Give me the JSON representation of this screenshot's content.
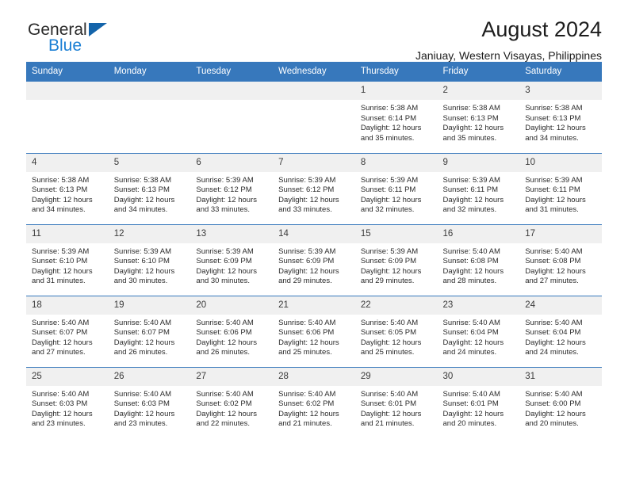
{
  "logo": {
    "word_primary": "General",
    "word_secondary": "Blue",
    "triangle_color": "#1464aa",
    "secondary_color": "#1b7fd4"
  },
  "header": {
    "title": "August 2024",
    "subtitle": "Janiuay, Western Visayas, Philippines"
  },
  "theme": {
    "header_bg": "#3778bc",
    "header_text": "#ffffff",
    "daynum_bg": "#f0f0f0",
    "row_rule": "#3778bc"
  },
  "weekdays": [
    "Sunday",
    "Monday",
    "Tuesday",
    "Wednesday",
    "Thursday",
    "Friday",
    "Saturday"
  ],
  "weeks": [
    [
      {
        "day": "",
        "sunrise": "",
        "sunset": "",
        "daylight_line1": "",
        "daylight_line2": ""
      },
      {
        "day": "",
        "sunrise": "",
        "sunset": "",
        "daylight_line1": "",
        "daylight_line2": ""
      },
      {
        "day": "",
        "sunrise": "",
        "sunset": "",
        "daylight_line1": "",
        "daylight_line2": ""
      },
      {
        "day": "",
        "sunrise": "",
        "sunset": "",
        "daylight_line1": "",
        "daylight_line2": ""
      },
      {
        "day": "1",
        "sunrise": "Sunrise: 5:38 AM",
        "sunset": "Sunset: 6:14 PM",
        "daylight_line1": "Daylight: 12 hours",
        "daylight_line2": "and 35 minutes."
      },
      {
        "day": "2",
        "sunrise": "Sunrise: 5:38 AM",
        "sunset": "Sunset: 6:13 PM",
        "daylight_line1": "Daylight: 12 hours",
        "daylight_line2": "and 35 minutes."
      },
      {
        "day": "3",
        "sunrise": "Sunrise: 5:38 AM",
        "sunset": "Sunset: 6:13 PM",
        "daylight_line1": "Daylight: 12 hours",
        "daylight_line2": "and 34 minutes."
      }
    ],
    [
      {
        "day": "4",
        "sunrise": "Sunrise: 5:38 AM",
        "sunset": "Sunset: 6:13 PM",
        "daylight_line1": "Daylight: 12 hours",
        "daylight_line2": "and 34 minutes."
      },
      {
        "day": "5",
        "sunrise": "Sunrise: 5:38 AM",
        "sunset": "Sunset: 6:13 PM",
        "daylight_line1": "Daylight: 12 hours",
        "daylight_line2": "and 34 minutes."
      },
      {
        "day": "6",
        "sunrise": "Sunrise: 5:39 AM",
        "sunset": "Sunset: 6:12 PM",
        "daylight_line1": "Daylight: 12 hours",
        "daylight_line2": "and 33 minutes."
      },
      {
        "day": "7",
        "sunrise": "Sunrise: 5:39 AM",
        "sunset": "Sunset: 6:12 PM",
        "daylight_line1": "Daylight: 12 hours",
        "daylight_line2": "and 33 minutes."
      },
      {
        "day": "8",
        "sunrise": "Sunrise: 5:39 AM",
        "sunset": "Sunset: 6:11 PM",
        "daylight_line1": "Daylight: 12 hours",
        "daylight_line2": "and 32 minutes."
      },
      {
        "day": "9",
        "sunrise": "Sunrise: 5:39 AM",
        "sunset": "Sunset: 6:11 PM",
        "daylight_line1": "Daylight: 12 hours",
        "daylight_line2": "and 32 minutes."
      },
      {
        "day": "10",
        "sunrise": "Sunrise: 5:39 AM",
        "sunset": "Sunset: 6:11 PM",
        "daylight_line1": "Daylight: 12 hours",
        "daylight_line2": "and 31 minutes."
      }
    ],
    [
      {
        "day": "11",
        "sunrise": "Sunrise: 5:39 AM",
        "sunset": "Sunset: 6:10 PM",
        "daylight_line1": "Daylight: 12 hours",
        "daylight_line2": "and 31 minutes."
      },
      {
        "day": "12",
        "sunrise": "Sunrise: 5:39 AM",
        "sunset": "Sunset: 6:10 PM",
        "daylight_line1": "Daylight: 12 hours",
        "daylight_line2": "and 30 minutes."
      },
      {
        "day": "13",
        "sunrise": "Sunrise: 5:39 AM",
        "sunset": "Sunset: 6:09 PM",
        "daylight_line1": "Daylight: 12 hours",
        "daylight_line2": "and 30 minutes."
      },
      {
        "day": "14",
        "sunrise": "Sunrise: 5:39 AM",
        "sunset": "Sunset: 6:09 PM",
        "daylight_line1": "Daylight: 12 hours",
        "daylight_line2": "and 29 minutes."
      },
      {
        "day": "15",
        "sunrise": "Sunrise: 5:39 AM",
        "sunset": "Sunset: 6:09 PM",
        "daylight_line1": "Daylight: 12 hours",
        "daylight_line2": "and 29 minutes."
      },
      {
        "day": "16",
        "sunrise": "Sunrise: 5:40 AM",
        "sunset": "Sunset: 6:08 PM",
        "daylight_line1": "Daylight: 12 hours",
        "daylight_line2": "and 28 minutes."
      },
      {
        "day": "17",
        "sunrise": "Sunrise: 5:40 AM",
        "sunset": "Sunset: 6:08 PM",
        "daylight_line1": "Daylight: 12 hours",
        "daylight_line2": "and 27 minutes."
      }
    ],
    [
      {
        "day": "18",
        "sunrise": "Sunrise: 5:40 AM",
        "sunset": "Sunset: 6:07 PM",
        "daylight_line1": "Daylight: 12 hours",
        "daylight_line2": "and 27 minutes."
      },
      {
        "day": "19",
        "sunrise": "Sunrise: 5:40 AM",
        "sunset": "Sunset: 6:07 PM",
        "daylight_line1": "Daylight: 12 hours",
        "daylight_line2": "and 26 minutes."
      },
      {
        "day": "20",
        "sunrise": "Sunrise: 5:40 AM",
        "sunset": "Sunset: 6:06 PM",
        "daylight_line1": "Daylight: 12 hours",
        "daylight_line2": "and 26 minutes."
      },
      {
        "day": "21",
        "sunrise": "Sunrise: 5:40 AM",
        "sunset": "Sunset: 6:06 PM",
        "daylight_line1": "Daylight: 12 hours",
        "daylight_line2": "and 25 minutes."
      },
      {
        "day": "22",
        "sunrise": "Sunrise: 5:40 AM",
        "sunset": "Sunset: 6:05 PM",
        "daylight_line1": "Daylight: 12 hours",
        "daylight_line2": "and 25 minutes."
      },
      {
        "day": "23",
        "sunrise": "Sunrise: 5:40 AM",
        "sunset": "Sunset: 6:04 PM",
        "daylight_line1": "Daylight: 12 hours",
        "daylight_line2": "and 24 minutes."
      },
      {
        "day": "24",
        "sunrise": "Sunrise: 5:40 AM",
        "sunset": "Sunset: 6:04 PM",
        "daylight_line1": "Daylight: 12 hours",
        "daylight_line2": "and 24 minutes."
      }
    ],
    [
      {
        "day": "25",
        "sunrise": "Sunrise: 5:40 AM",
        "sunset": "Sunset: 6:03 PM",
        "daylight_line1": "Daylight: 12 hours",
        "daylight_line2": "and 23 minutes."
      },
      {
        "day": "26",
        "sunrise": "Sunrise: 5:40 AM",
        "sunset": "Sunset: 6:03 PM",
        "daylight_line1": "Daylight: 12 hours",
        "daylight_line2": "and 23 minutes."
      },
      {
        "day": "27",
        "sunrise": "Sunrise: 5:40 AM",
        "sunset": "Sunset: 6:02 PM",
        "daylight_line1": "Daylight: 12 hours",
        "daylight_line2": "and 22 minutes."
      },
      {
        "day": "28",
        "sunrise": "Sunrise: 5:40 AM",
        "sunset": "Sunset: 6:02 PM",
        "daylight_line1": "Daylight: 12 hours",
        "daylight_line2": "and 21 minutes."
      },
      {
        "day": "29",
        "sunrise": "Sunrise: 5:40 AM",
        "sunset": "Sunset: 6:01 PM",
        "daylight_line1": "Daylight: 12 hours",
        "daylight_line2": "and 21 minutes."
      },
      {
        "day": "30",
        "sunrise": "Sunrise: 5:40 AM",
        "sunset": "Sunset: 6:01 PM",
        "daylight_line1": "Daylight: 12 hours",
        "daylight_line2": "and 20 minutes."
      },
      {
        "day": "31",
        "sunrise": "Sunrise: 5:40 AM",
        "sunset": "Sunset: 6:00 PM",
        "daylight_line1": "Daylight: 12 hours",
        "daylight_line2": "and 20 minutes."
      }
    ]
  ]
}
